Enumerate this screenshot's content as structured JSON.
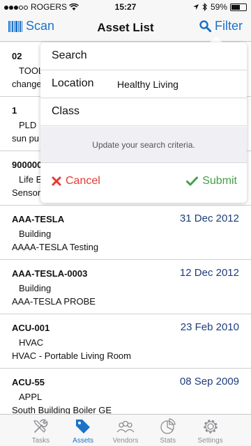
{
  "status": {
    "carrier": "ROGERS",
    "time": "15:27",
    "battery": "59%",
    "battery_level": 0.59
  },
  "nav": {
    "scan_label": "Scan",
    "title": "Asset List",
    "filter_label": "Filter"
  },
  "rows": [
    {
      "code": "02",
      "date": "",
      "type": "TOOL",
      "desc": "change"
    },
    {
      "code": "1",
      "date": "",
      "type": "PLD",
      "desc": "sun pu"
    },
    {
      "code": "900000",
      "date": "",
      "type": "Life E",
      "desc": "Sensor"
    },
    {
      "code": "AAA-TESLA",
      "date": "31 Dec 2012",
      "type": "Building",
      "desc": "AAAA-TESLA Testing"
    },
    {
      "code": "AAA-TESLA-0003",
      "date": "12 Dec 2012",
      "type": "Building",
      "desc": "AAA-TESLA PROBE"
    },
    {
      "code": "ACU-001",
      "date": "23 Feb 2010",
      "type": "HVAC",
      "desc": "HVAC - Portable Living Room"
    },
    {
      "code": "ACU-55",
      "date": "08 Sep 2009",
      "type": "APPL",
      "desc": "South Building Boiler GE"
    }
  ],
  "filter": {
    "search_label": "Search",
    "location_label": "Location",
    "location_value": "Healthy Living",
    "class_label": "Class",
    "hint": "Update your search criteria.",
    "cancel_label": "Cancel",
    "submit_label": "Submit"
  },
  "tabs": [
    {
      "label": "Tasks",
      "icon": "tools-icon",
      "active": false
    },
    {
      "label": "Assets",
      "icon": "tag-icon",
      "active": true
    },
    {
      "label": "Vendors",
      "icon": "people-icon",
      "active": false
    },
    {
      "label": "Stats",
      "icon": "pie-chart-icon",
      "active": false
    },
    {
      "label": "Settings",
      "icon": "gear-icon",
      "active": false
    }
  ],
  "colors": {
    "accent": "#1a73c9",
    "date": "#1d3d78",
    "cancel": "#e53935",
    "submit": "#43a047",
    "inactive_tab": "#8e8e93"
  }
}
